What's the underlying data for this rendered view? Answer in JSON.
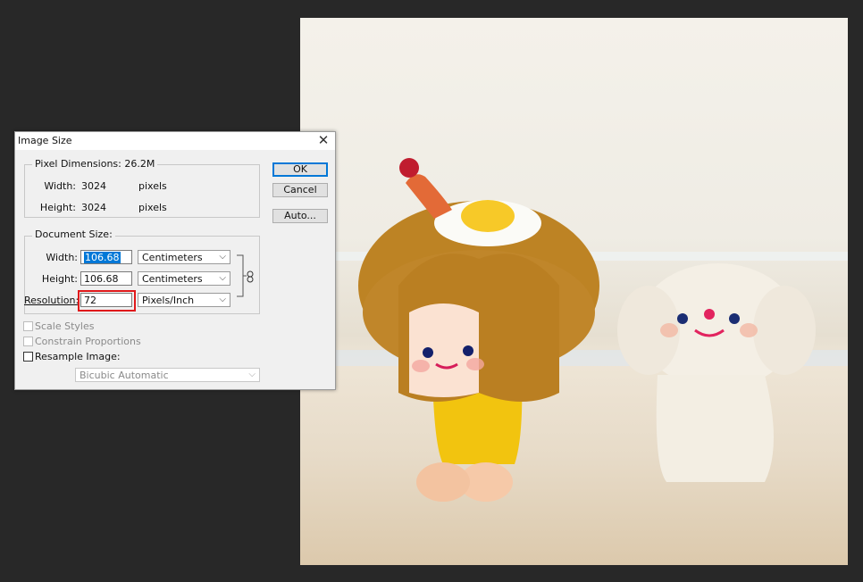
{
  "dialog": {
    "title": "Image Size",
    "close_glyph": "✕",
    "pixel_dimensions": {
      "legend": "Pixel Dimensions:  26.2M",
      "width_label": "Width:",
      "width_value": "3024",
      "width_unit": "pixels",
      "height_label": "Height:",
      "height_value": "3024",
      "height_unit": "pixels"
    },
    "document_size": {
      "legend": "Document Size:",
      "width_label": "Width:",
      "width_value": "106.68",
      "width_unit": "Centimeters",
      "height_label": "Height:",
      "height_value": "106.68",
      "height_unit": "Centimeters",
      "resolution_label": "Resolution:",
      "resolution_value": "72",
      "resolution_unit": "Pixels/Inch",
      "link_icon": "chain-link-icon"
    },
    "options": {
      "scale_styles": "Scale Styles",
      "constrain_proportions": "Constrain Proportions",
      "resample_image": "Resample Image:",
      "resample_method": "Bicubic Automatic",
      "scale_styles_checked": false,
      "constrain_checked": false,
      "resample_checked": false
    },
    "buttons": {
      "ok": "OK",
      "cancel": "Cancel",
      "auto": "Auto..."
    }
  },
  "colors": {
    "workspace": "#282828",
    "highlight": "#e0191b",
    "selection": "#0078d7"
  }
}
